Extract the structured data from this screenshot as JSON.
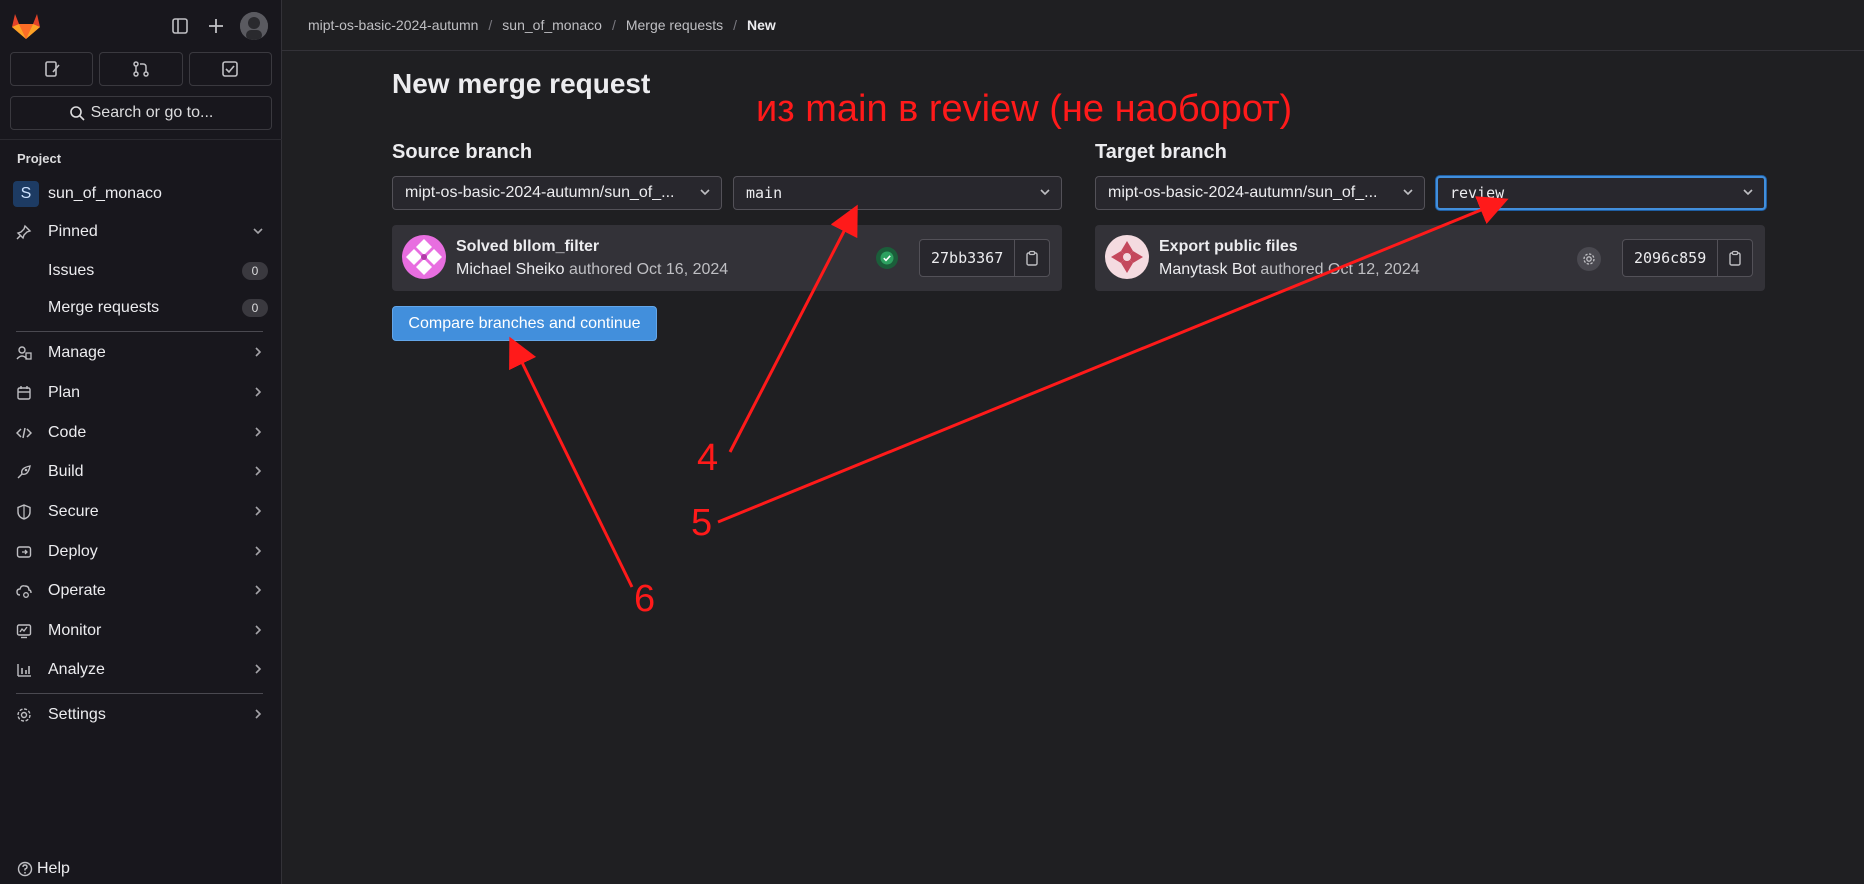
{
  "breadcrumb": {
    "items": [
      "mipt-os-basic-2024-autumn",
      "sun_of_monaco",
      "Merge requests"
    ],
    "current": "New"
  },
  "sidebar": {
    "search_label": "Search or go to...",
    "section_label": "Project",
    "project_initial": "S",
    "project_name": "sun_of_monaco",
    "pinned_label": "Pinned",
    "issues_label": "Issues",
    "issues_count": "0",
    "mr_label": "Merge requests",
    "mr_count": "0",
    "nav": [
      "Manage",
      "Plan",
      "Code",
      "Build",
      "Secure",
      "Deploy",
      "Operate",
      "Monitor",
      "Analyze"
    ],
    "settings_label": "Settings",
    "help_label": "Help"
  },
  "main": {
    "title": "New merge request",
    "source": {
      "heading": "Source branch",
      "project": "mipt-os-basic-2024-autumn/sun_of_...",
      "branch": "main",
      "commit_title": "Solved bllom_filter",
      "commit_author": "Michael Sheiko",
      "commit_authored": "authored Oct 16, 2024",
      "sha": "27bb3367"
    },
    "target": {
      "heading": "Target branch",
      "project": "mipt-os-basic-2024-autumn/sun_of_...",
      "branch": "review",
      "commit_title": "Export public files",
      "commit_author": "Manytask Bot",
      "commit_authored": "authored Oct 12, 2024",
      "sha": "2096c859"
    },
    "compare_button": "Compare branches and continue"
  },
  "annotations": {
    "caption": "из main в review (не наоборот)",
    "n4": "4",
    "n5": "5",
    "n6": "6",
    "color": "#ff1a1a"
  },
  "colors": {
    "background": "#1f1f22",
    "sidebar": "#18171d",
    "accent": "#428fdc",
    "success": "#1b5e3a"
  }
}
